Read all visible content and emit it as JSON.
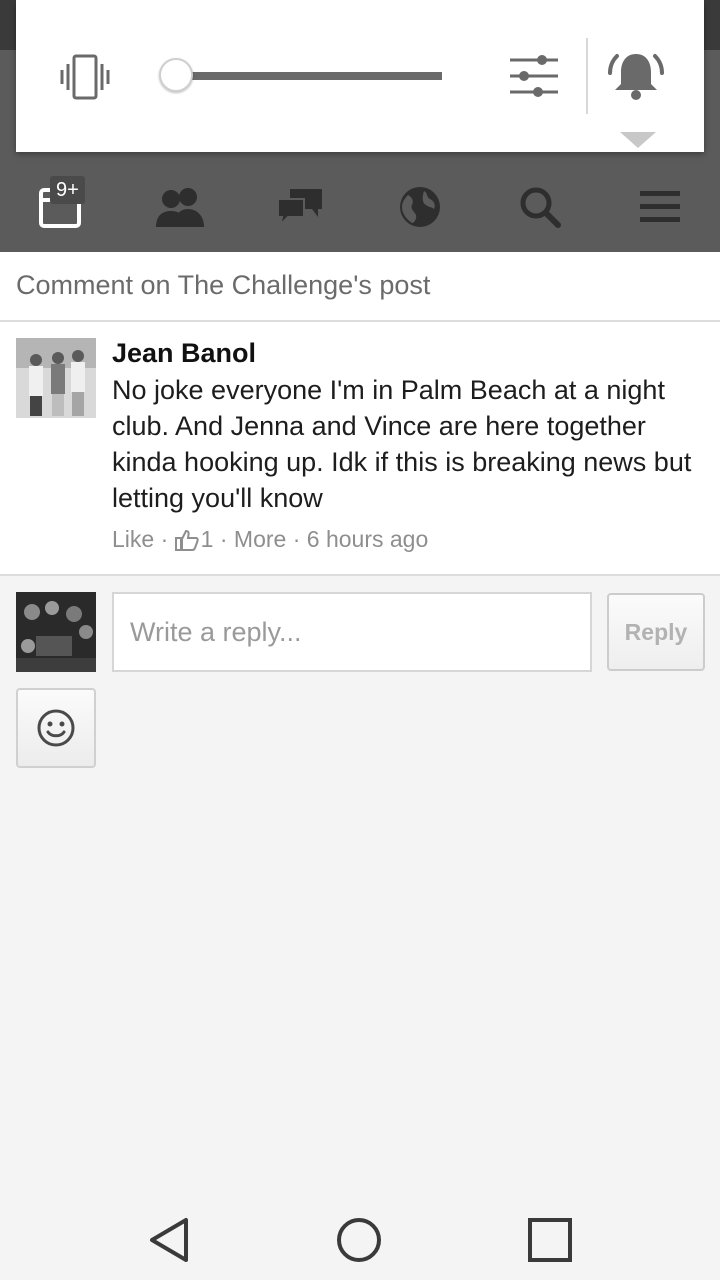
{
  "volume_panel": {
    "level": 0.0,
    "icons": [
      "vibrate-icon",
      "settings-sliders-icon",
      "bell-icon",
      "expand-arrow-icon"
    ]
  },
  "nav_bar": {
    "items": [
      {
        "icon": "notifications-icon",
        "badge": "9+"
      },
      {
        "icon": "friends-icon"
      },
      {
        "icon": "messages-icon"
      },
      {
        "icon": "globe-icon"
      },
      {
        "icon": "search-icon"
      },
      {
        "icon": "menu-icon"
      }
    ]
  },
  "header": {
    "title": "Comment on The Challenge's post"
  },
  "comment": {
    "author": "Jean Banol",
    "text": "No joke everyone I'm in Palm Beach at a night club. And Jenna and Vince are here together kinda hooking up. Idk if this is breaking news but letting you'll know",
    "like_label": "Like",
    "separator": " · ",
    "like_count": "1",
    "more_label": "More",
    "time": "6 hours ago"
  },
  "reply": {
    "placeholder": "Write a reply...",
    "button_label": "Reply"
  },
  "colors": {
    "nav_bg": "#5b5b5b",
    "page_bg": "#f4f4f4"
  }
}
